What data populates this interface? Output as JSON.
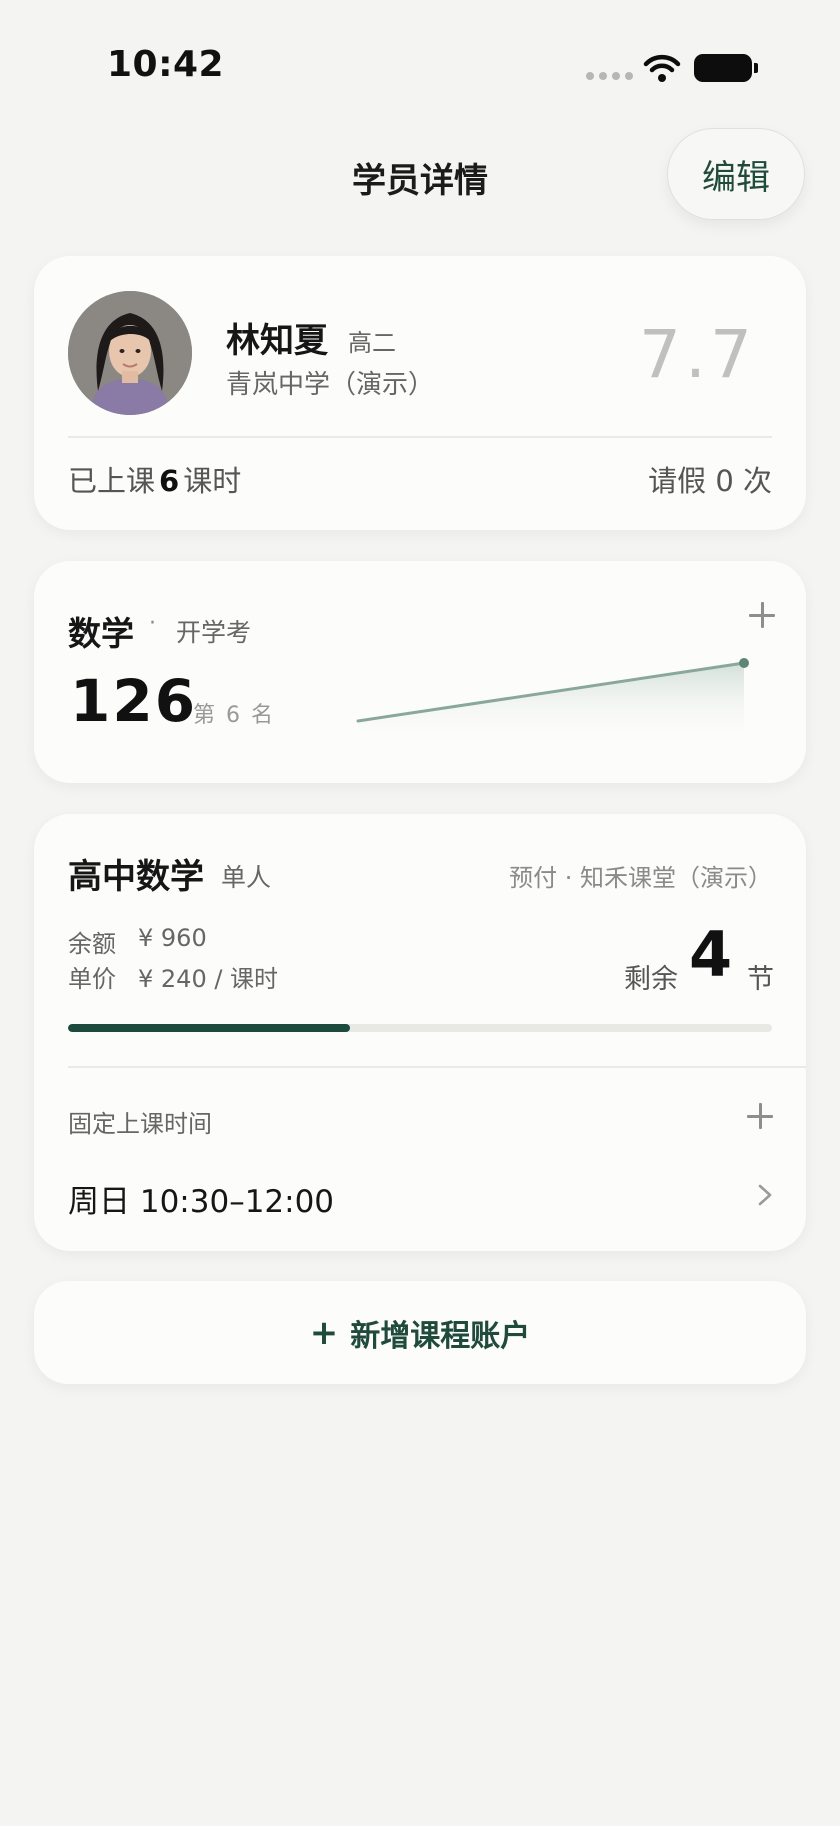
{
  "status_bar": {
    "time": "10:42",
    "signal_icon": "cellular-dots-icon",
    "wifi_icon": "wifi-icon",
    "battery_icon": "battery-icon"
  },
  "header": {
    "title": "学员详情",
    "edit_label": "编辑"
  },
  "student": {
    "name": "林知夏",
    "grade": "高二",
    "school": "青岚中学（演示）",
    "score": "7.7",
    "attended_prefix": "已上课",
    "attended_count": "6",
    "attended_unit": "课时",
    "leave_text": "请假 0 次"
  },
  "exam": {
    "subject": "数学",
    "separator": "·",
    "name": "开学考",
    "score": "126",
    "rank": "第 6 名",
    "add_icon": "plus-icon"
  },
  "course": {
    "name": "高中数学",
    "type": "单人",
    "meta": "预付 · 知禾课堂（演示）",
    "balance_label": "余额",
    "balance_value": "¥ 960",
    "price_label": "单价",
    "price_value": "¥ 240 / 课时",
    "remain_label": "剩余",
    "remain_count": "4",
    "remain_unit": "节",
    "progress_fraction": 0.4,
    "fixed_time_label": "固定上课时间",
    "schedule": [
      {
        "text": "周日 10:30–12:00"
      }
    ]
  },
  "add_course": {
    "label": "新增课程账户"
  },
  "colors": {
    "accent": "#1c4a3c",
    "trend_line": "#8aa89a",
    "background": "#f4f4f2",
    "card": "#fcfcfa"
  }
}
